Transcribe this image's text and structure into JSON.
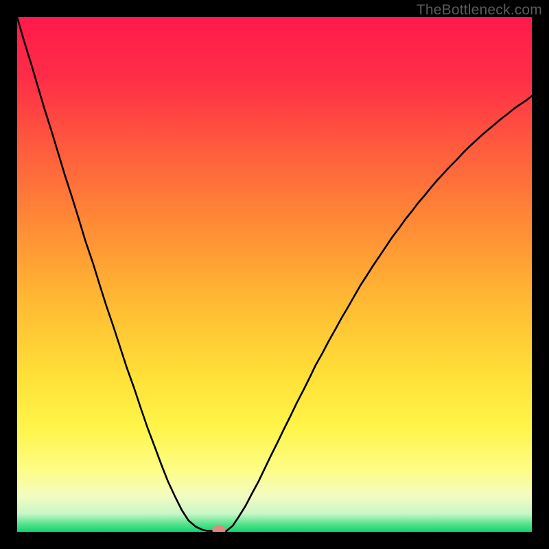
{
  "watermark": "TheBottleneck.com",
  "chart_data": {
    "type": "line",
    "title": "",
    "xlabel": "",
    "ylabel": "",
    "xlim": [
      0,
      100
    ],
    "ylim": [
      0,
      100
    ],
    "gradient_stops": [
      {
        "pos": 0.0,
        "color": "#ff1a4b"
      },
      {
        "pos": 0.12,
        "color": "#ff2e47"
      },
      {
        "pos": 0.25,
        "color": "#ff5a3e"
      },
      {
        "pos": 0.4,
        "color": "#ff8a36"
      },
      {
        "pos": 0.55,
        "color": "#ffb933"
      },
      {
        "pos": 0.7,
        "color": "#ffe138"
      },
      {
        "pos": 0.8,
        "color": "#fff54a"
      },
      {
        "pos": 0.88,
        "color": "#fdfd86"
      },
      {
        "pos": 0.93,
        "color": "#f4fbc1"
      },
      {
        "pos": 0.965,
        "color": "#c8f6c6"
      },
      {
        "pos": 0.985,
        "color": "#55e28c"
      },
      {
        "pos": 1.0,
        "color": "#0ed573"
      }
    ],
    "series": [
      {
        "name": "bottleneck-curve-left",
        "x": [
          0,
          1.3,
          2.7,
          4.0,
          5.3,
          6.7,
          8.0,
          9.3,
          10.7,
          12.0,
          13.3,
          14.7,
          16.0,
          17.3,
          18.7,
          20.0,
          21.3,
          22.7,
          24.0,
          25.3,
          26.7,
          28.0,
          29.3,
          30.7,
          32.0,
          33.3,
          34.7,
          36.0,
          36.9,
          37.7
        ],
        "y": [
          100,
          95.5,
          91.0,
          86.6,
          82.2,
          77.8,
          73.5,
          69.2,
          64.9,
          60.7,
          56.4,
          52.3,
          48.1,
          44.0,
          39.9,
          35.9,
          31.9,
          28.0,
          24.1,
          20.3,
          16.6,
          13.1,
          9.8,
          6.8,
          4.2,
          2.2,
          1.0,
          0.4,
          0.2,
          0.2
        ]
      },
      {
        "name": "bottleneck-curve-right",
        "x": [
          40.7,
          41.9,
          43.1,
          44.4,
          45.6,
          46.9,
          48.1,
          49.3,
          50.6,
          51.8,
          53.1,
          54.3,
          55.6,
          56.8,
          58.0,
          59.3,
          60.5,
          61.8,
          63.0,
          64.3,
          65.5,
          66.7,
          68.0,
          69.2,
          70.5,
          71.7,
          72.9,
          74.2,
          75.4,
          76.7,
          77.9,
          79.2,
          80.4,
          81.6,
          82.9,
          84.1,
          85.4,
          86.6,
          87.8,
          89.1,
          90.3,
          91.6,
          92.8,
          94.1,
          95.3,
          96.5,
          97.8,
          99.0,
          100
        ],
        "y": [
          0.2,
          1.2,
          3.0,
          5.1,
          7.4,
          9.8,
          12.3,
          14.8,
          17.4,
          19.9,
          22.5,
          25.0,
          27.5,
          29.9,
          32.4,
          34.7,
          37.0,
          39.3,
          41.5,
          43.7,
          45.8,
          47.9,
          49.9,
          51.8,
          53.7,
          55.5,
          57.3,
          59.0,
          60.7,
          62.3,
          63.9,
          65.4,
          66.9,
          68.3,
          69.7,
          71.0,
          72.3,
          73.6,
          74.8,
          76.0,
          77.1,
          78.2,
          79.2,
          80.3,
          81.2,
          82.2,
          83.1,
          83.9,
          84.7
        ]
      }
    ],
    "marker": {
      "x": 39.2,
      "y": 0.4,
      "rx": 1.3,
      "ry": 0.9,
      "color": "#d98b82"
    },
    "annotations": []
  }
}
